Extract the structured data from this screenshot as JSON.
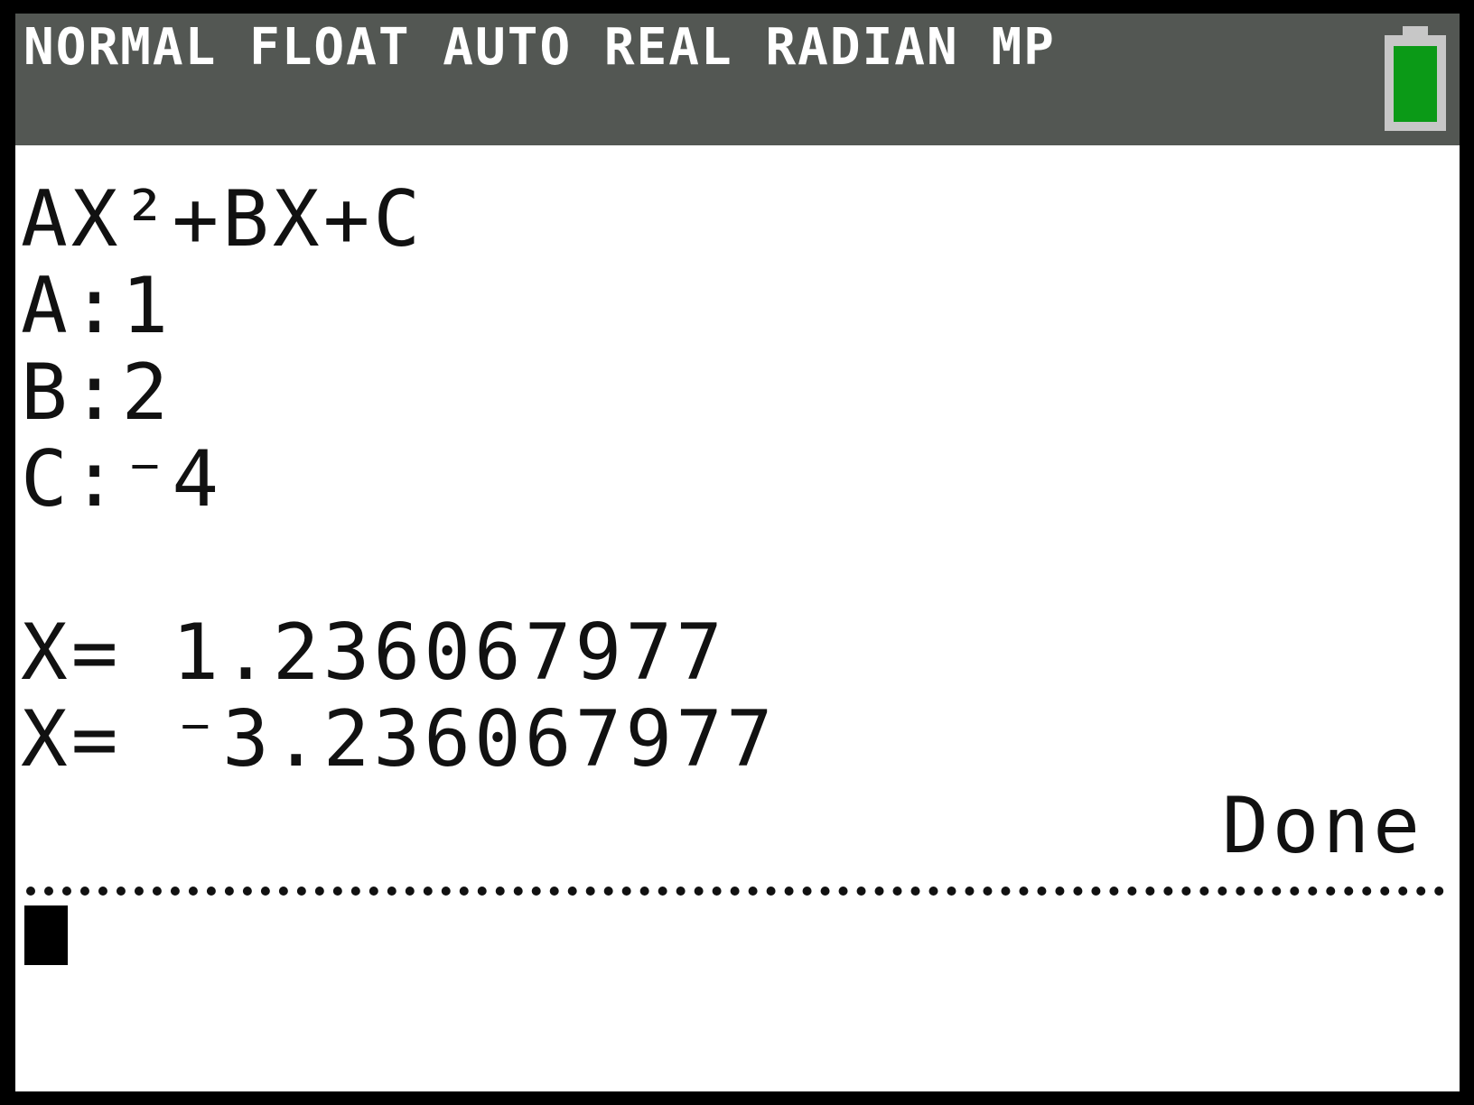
{
  "status_bar": {
    "text": "NORMAL FLOAT AUTO REAL RADIAN MP",
    "battery_color": "#0b9a17"
  },
  "home_screen": {
    "lines": [
      "AX²+BX+C",
      "A:1",
      "B:2",
      "C:⁻4",
      "",
      "X= 1.236067977",
      "X= ⁻3.236067977"
    ],
    "result": "Done"
  },
  "colors": {
    "status_bar_bg": "#535753",
    "screen_bg": "#ffffff",
    "text": "#111111"
  }
}
